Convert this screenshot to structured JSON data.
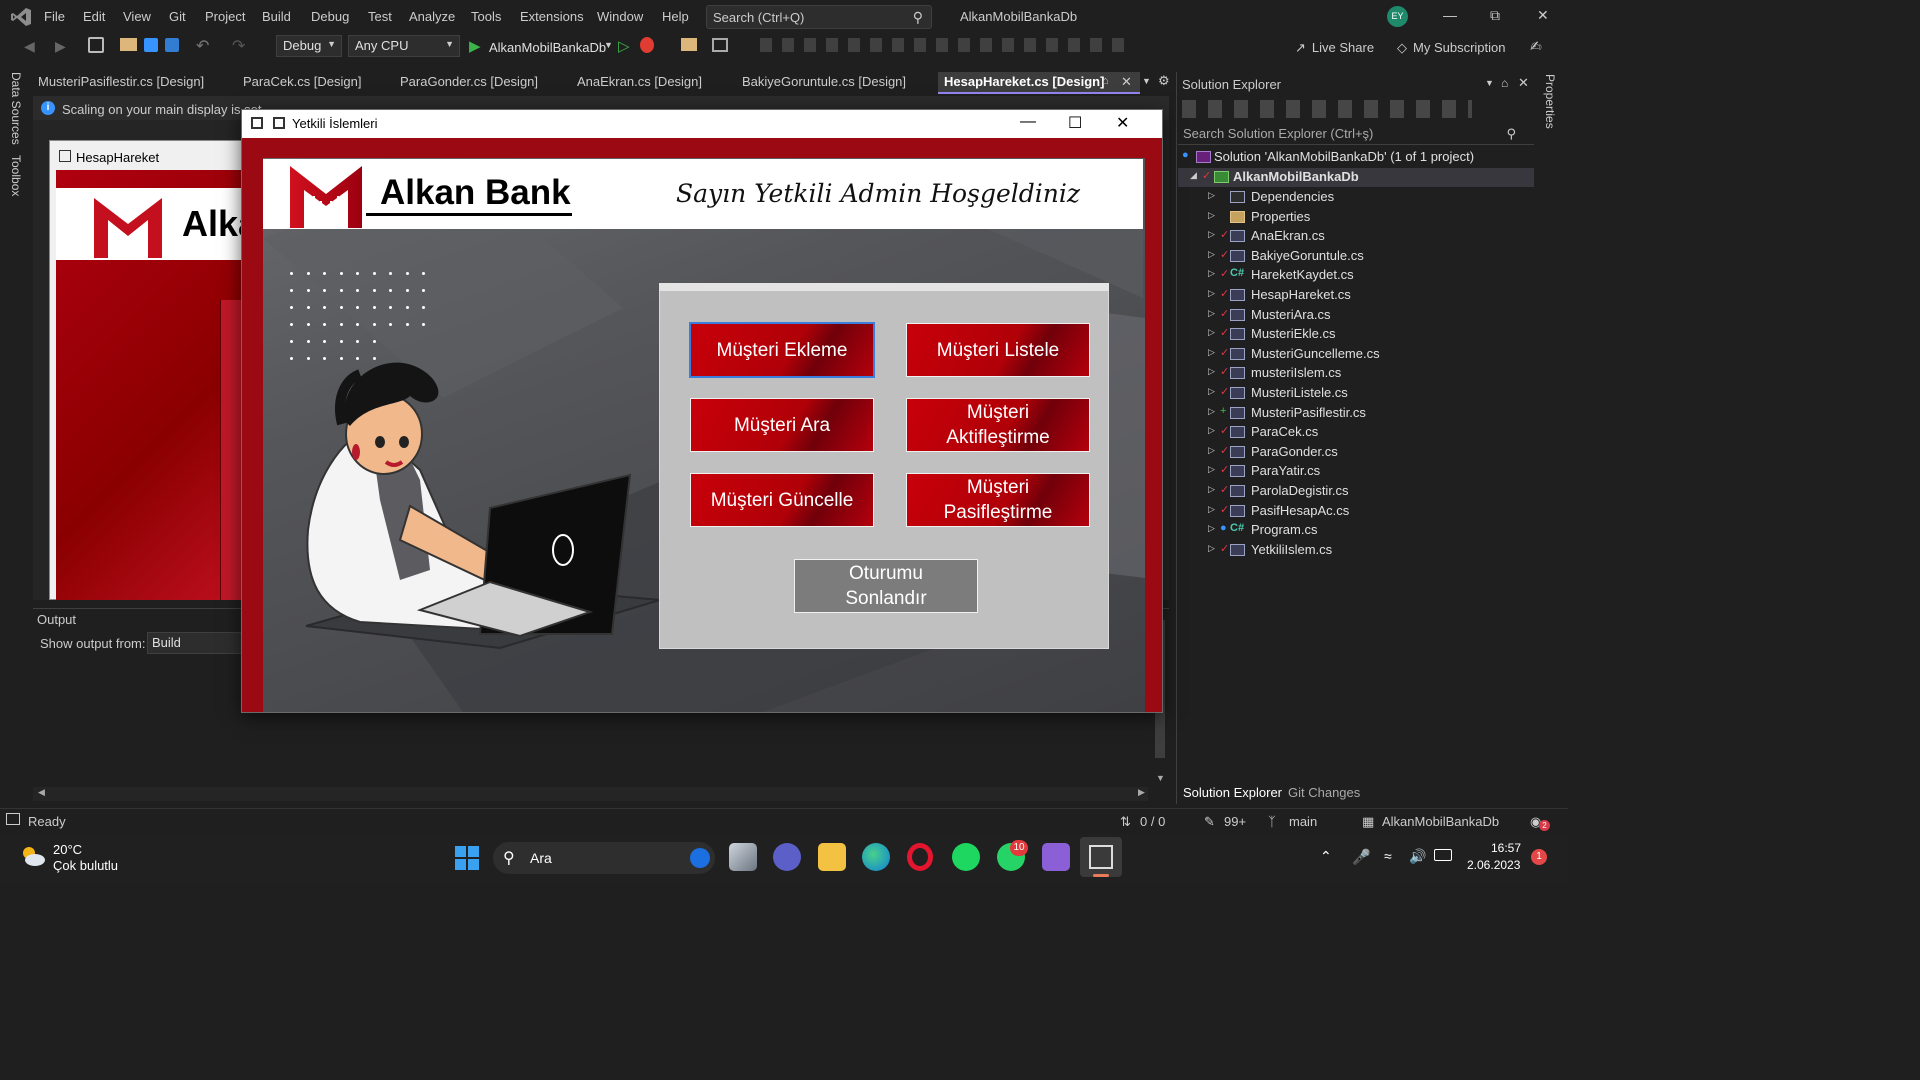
{
  "menubar": {
    "items": [
      "File",
      "Edit",
      "View",
      "Git",
      "Project",
      "Build",
      "Debug",
      "Test",
      "Analyze",
      "Tools",
      "Extensions",
      "Window",
      "Help"
    ],
    "search_placeholder": "Search (Ctrl+Q)",
    "solution_name": "AlkanMobilBankaDb",
    "avatar_initials": "EY"
  },
  "toolbar": {
    "config": "Debug",
    "platform": "Any CPU",
    "run_target": "AlkanMobilBankaDb",
    "live_share": "Live Share",
    "subscription": "My Subscription"
  },
  "side_tabs": [
    "Data Sources",
    "Toolbox"
  ],
  "right_side_tab": "Properties",
  "doc_tabs": [
    "MusteriPasiflestir.cs [Design]",
    "ParaCek.cs [Design]",
    "ParaGonder.cs [Design]",
    "AnaEkran.cs [Design]",
    "BakiyeGoruntule.cs [Design]",
    "HesapHareket.cs [Design]"
  ],
  "active_doc_tab": "HesapHareket.cs [Design]",
  "infobar": {
    "text": "Scaling on your main display is set"
  },
  "designer": {
    "form_title": "HesapHareket",
    "bank_fragment": "Alka"
  },
  "output": {
    "title": "Output",
    "show_from_label": "Show output from:",
    "source": "Build"
  },
  "solution_explorer": {
    "title": "Solution Explorer",
    "search_placeholder": "Search Solution Explorer (Ctrl+ş)",
    "solution_line": "Solution 'AlkanMobilBankaDb' (1 of 1 project)",
    "project": "AlkanMobilBankaDb",
    "items": [
      "Dependencies",
      "Properties",
      "AnaEkran.cs",
      "BakiyeGoruntule.cs",
      "HareketKaydet.cs",
      "HesapHareket.cs",
      "MusteriAra.cs",
      "MusteriEkle.cs",
      "MusteriGuncelleme.cs",
      "musteriIslem.cs",
      "MusteriListele.cs",
      "MusteriPasiflestir.cs",
      "ParaCek.cs",
      "ParaGonder.cs",
      "ParaYatir.cs",
      "ParolaDegistir.cs",
      "PasifHesapAc.cs",
      "Program.cs",
      "YetkiliIslem.cs"
    ],
    "bottom_tabs": [
      "Solution Explorer",
      "Git Changes"
    ]
  },
  "statusbar": {
    "ready": "Ready",
    "sync": "0 / 0",
    "edits": "99+",
    "branch": "main",
    "repo": "AlkanMobilBankaDb",
    "notif_count": "2"
  },
  "taskbar": {
    "weather_temp": "20°C",
    "weather_desc": "Çok bulutlu",
    "search_label": "Ara",
    "whatsapp_badge": "10",
    "time": "16:57",
    "date": "2.06.2023",
    "notif_badge": "1"
  },
  "app_window": {
    "title": "Yetkili İslemleri",
    "bank_name": "Alkan Bank",
    "welcome": "Sayın Yetkili Admin Hoşgeldiniz",
    "buttons": {
      "add": "Müşteri Ekleme",
      "list": "Müşteri Listele",
      "search": "Müşteri Ara",
      "activate": "Müşteri Aktifleştirme",
      "update": "Müşteri Güncelle",
      "deactivate": "Müşteri Pasifleştirme",
      "logout": "Oturumu Sonlandır"
    }
  },
  "colors": {
    "brand_red": "#c8000a",
    "vs_bg": "#1f1f1f",
    "accent": "#9184ee"
  }
}
